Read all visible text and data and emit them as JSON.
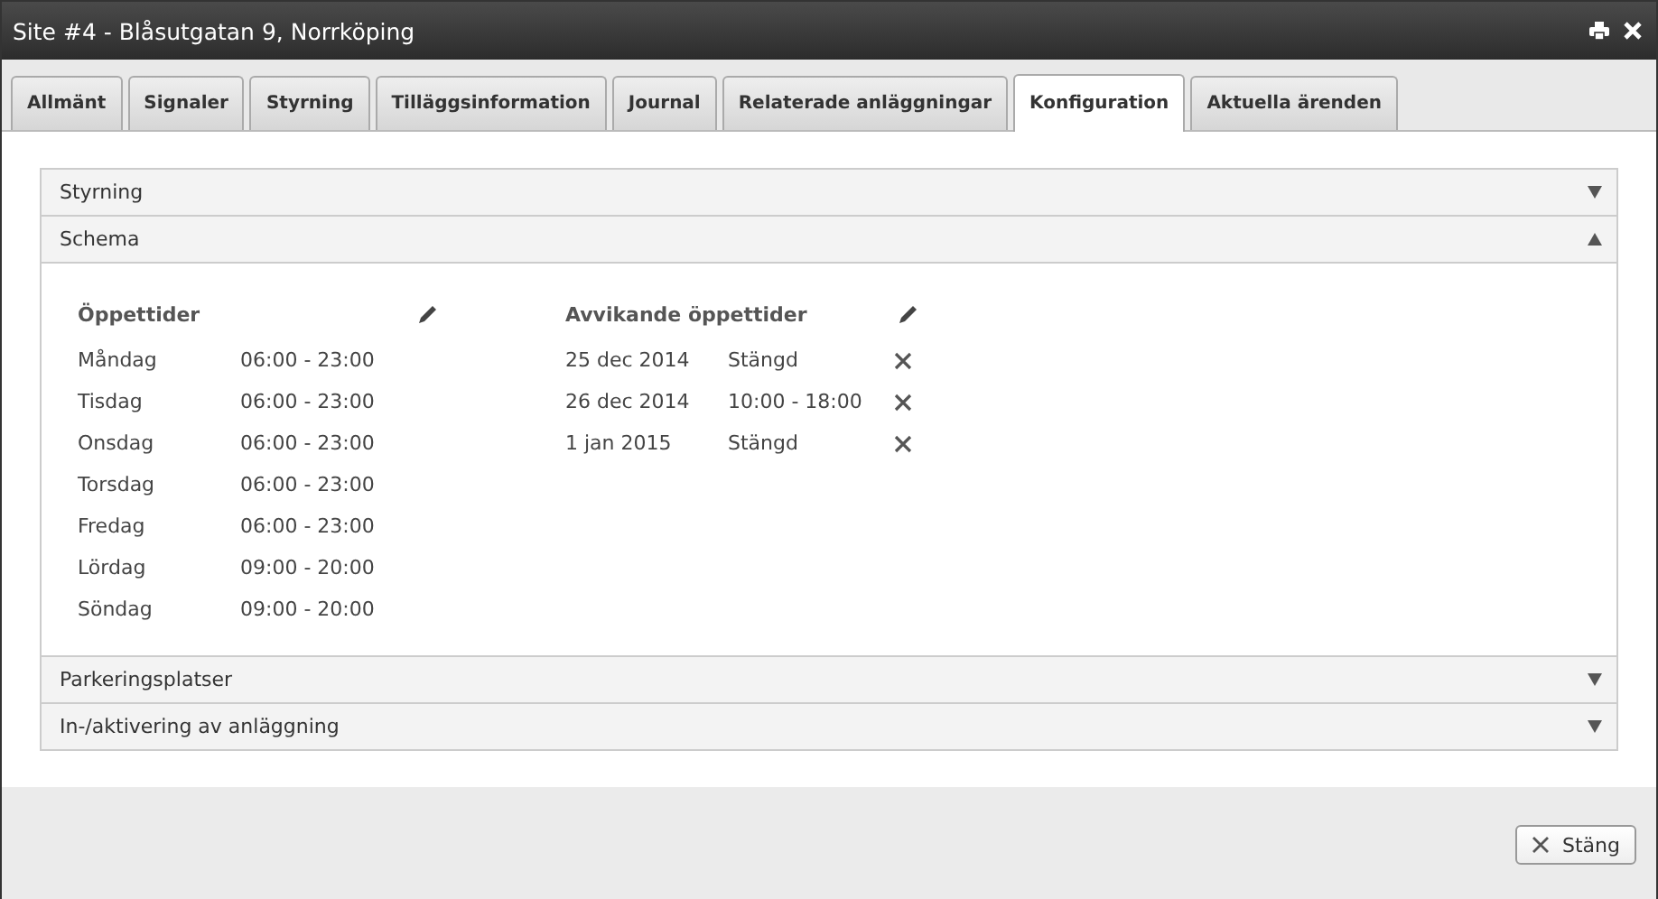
{
  "window": {
    "title": "Site #4 - Blåsutgatan 9, Norrköping"
  },
  "tabs": [
    {
      "label": "Allmänt",
      "selected": false
    },
    {
      "label": "Signaler",
      "selected": false
    },
    {
      "label": "Styrning",
      "selected": false
    },
    {
      "label": "Tilläggsinformation",
      "selected": false
    },
    {
      "label": "Journal",
      "selected": false
    },
    {
      "label": "Relaterade anläggningar",
      "selected": false
    },
    {
      "label": "Konfiguration",
      "selected": true
    },
    {
      "label": "Aktuella ärenden",
      "selected": false
    }
  ],
  "sections": [
    {
      "title": "Styrning",
      "expanded": false
    },
    {
      "title": "Schema",
      "expanded": true
    },
    {
      "title": "Parkeringsplatser",
      "expanded": false
    },
    {
      "title": "In-/aktivering av anläggning",
      "expanded": false
    }
  ],
  "schedule": {
    "opening_hours": {
      "heading": "Öppettider",
      "rows": [
        {
          "day": "Måndag",
          "hours": "06:00 - 23:00"
        },
        {
          "day": "Tisdag",
          "hours": "06:00 - 23:00"
        },
        {
          "day": "Onsdag",
          "hours": "06:00 - 23:00"
        },
        {
          "day": "Torsdag",
          "hours": "06:00 - 23:00"
        },
        {
          "day": "Fredag",
          "hours": "06:00 - 23:00"
        },
        {
          "day": "Lördag",
          "hours": "09:00 - 20:00"
        },
        {
          "day": "Söndag",
          "hours": "09:00 - 20:00"
        }
      ]
    },
    "exceptions": {
      "heading": "Avvikande öppettider",
      "rows": [
        {
          "date": "25 dec 2014",
          "hours": "Stängd"
        },
        {
          "date": "26 dec 2014",
          "hours": "10:00 - 18:00"
        },
        {
          "date": "1 jan 2015",
          "hours": "Stängd"
        }
      ]
    }
  },
  "footer": {
    "close_button": "Stäng"
  }
}
